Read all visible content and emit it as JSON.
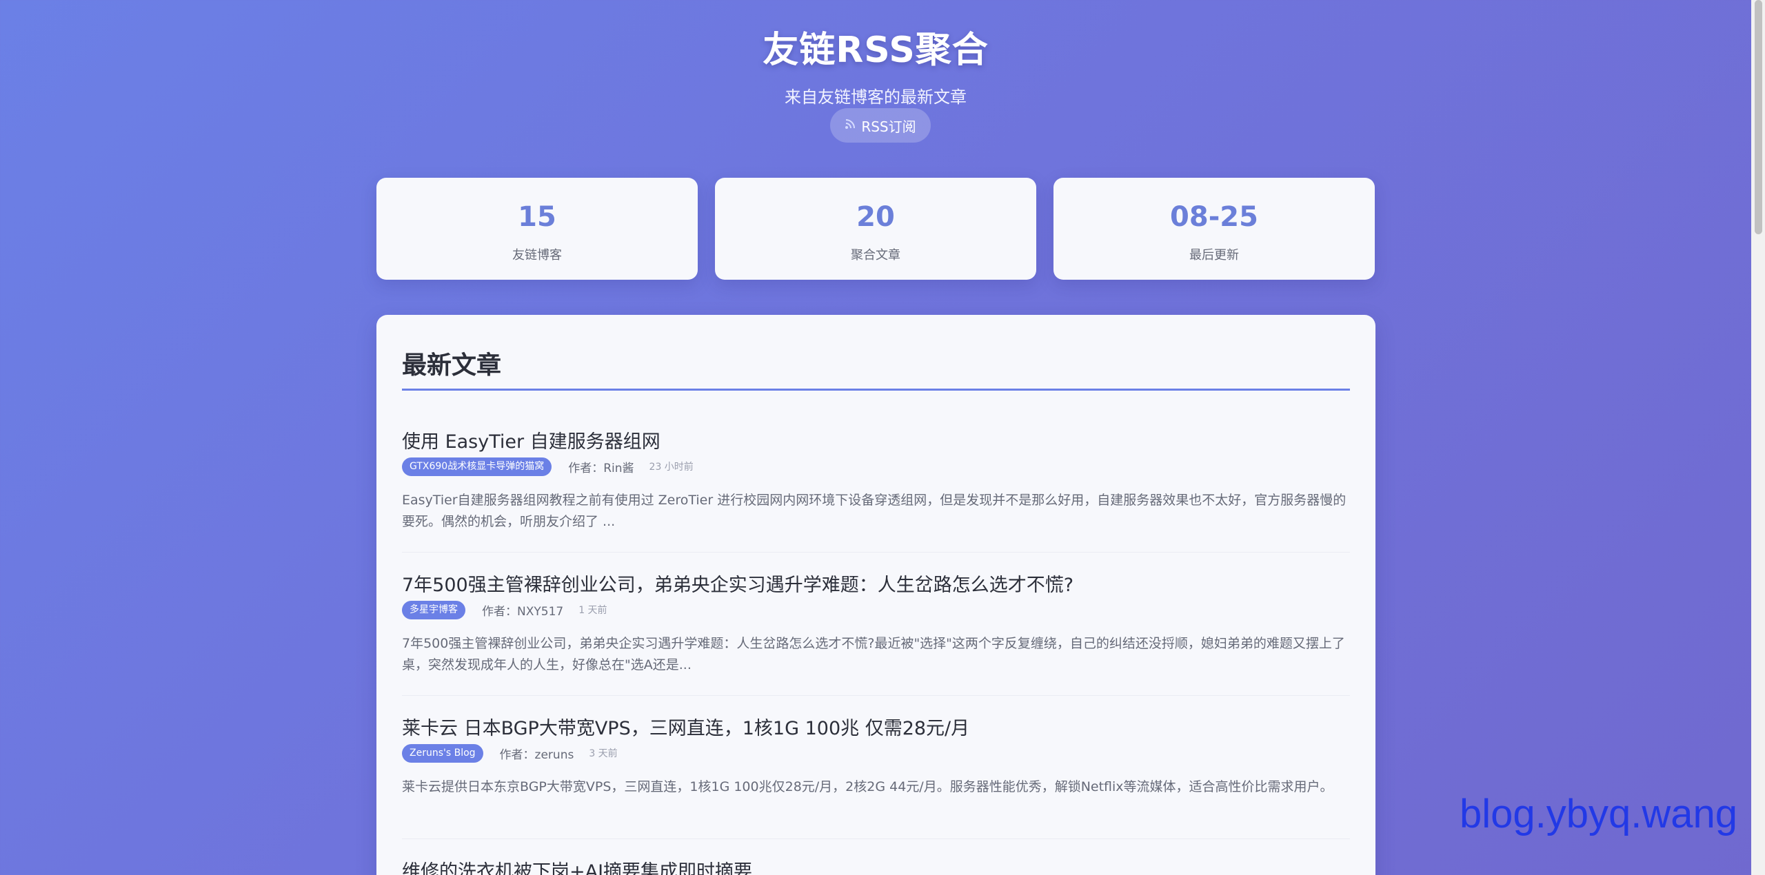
{
  "header": {
    "title": "友链RSS聚合",
    "subtitle": "来自友链博客的最新文章",
    "rss_button_label": "RSS订阅",
    "rss_icon": "rss-icon"
  },
  "stats": [
    {
      "value": "15",
      "label": "友链博客"
    },
    {
      "value": "20",
      "label": "聚合文章"
    },
    {
      "value": "08-25",
      "label": "最后更新"
    }
  ],
  "main": {
    "section_title": "最新文章",
    "articles": [
      {
        "title": "使用 EasyTier 自建服务器组网",
        "tag": "GTX690战术核显卡导弹的猫窝",
        "author": "作者：Rin酱",
        "time": "23 小时前",
        "summary": "EasyTier自建服务器组网教程之前有使用过 ZeroTier 进行校园网内网环境下设备穿透组网，但是发现并不是那么好用，自建服务器效果也不太好，官方服务器慢的要死。偶然的机会，听朋友介绍了 ..."
      },
      {
        "title": "7年500强主管裸辞创业公司，弟弟央企实习遇升学难题：人生岔路怎么选才不慌?",
        "tag": "多星宇博客",
        "author": "作者：NXY517",
        "time": "1 天前",
        "summary": "7年500强主管裸辞创业公司，弟弟央企实习遇升学难题：人生岔路怎么选才不慌?最近被\"选择\"这两个字反复缠绕，自己的纠结还没捋顺，媳妇弟弟的难题又摆上了桌，突然发现成年人的人生，好像总在\"选A还是..."
      },
      {
        "title": "莱卡云 日本BGP大带宽VPS，三网直连，1核1G 100兆 仅需28元/月",
        "tag": "Zeruns's Blog",
        "author": "作者：zeruns",
        "time": "3 天前",
        "summary": "莱卡云提供日本东京BGP大带宽VPS，三网直连，1核1G 100兆仅28元/月，2核2G 44元/月。服务器性能优秀，解锁Netflix等流媒体，适合高性价比需求用户。"
      },
      {
        "title": "维修的洗衣机被下岗+AI摘要集成即时摘要",
        "tag": "",
        "author": "",
        "time": "",
        "summary": ""
      }
    ]
  },
  "watermark": "blog.ybyq.wang"
}
